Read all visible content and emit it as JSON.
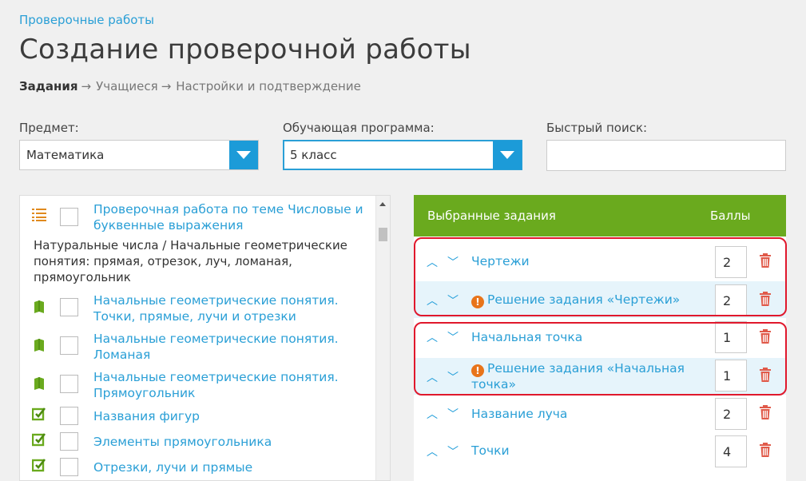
{
  "breadcrumb": "Проверочные работы",
  "title": "Создание проверочной работы",
  "steps": {
    "step1": "Задания",
    "arrow": "→",
    "step2": "Учащиеся",
    "step3": "Настройки и подтверждение"
  },
  "filters": {
    "subject_label": "Предмет:",
    "subject_value": "Математика",
    "program_label": "Обучающая программа:",
    "program_value": "5 класс",
    "search_label": "Быстрый поиск:",
    "search_value": ""
  },
  "task_list": {
    "items": [
      {
        "icon": "list-icon",
        "text": "Проверочная работа по теме Числовые и буквенные выражения"
      },
      {
        "icon": "book-icon",
        "text": "Начальные геометрические понятия. Точки, прямые, лучи и отрезки"
      },
      {
        "icon": "book-icon",
        "text": "Начальные геометрические понятия. Ломаная"
      },
      {
        "icon": "book-icon",
        "text": "Начальные геометрические понятия. Прямоугольник"
      },
      {
        "icon": "edit-check-icon",
        "text": "Названия фигур"
      },
      {
        "icon": "edit-check-icon",
        "text": "Элементы прямоугольника"
      },
      {
        "icon": "edit-check-icon",
        "text": "Отрезки, лучи и прямые"
      }
    ],
    "group_heading": "Натуральные числа / Начальные геометрические понятия: прямая, отрезок, луч, ломаная, прямоугольник"
  },
  "selected": {
    "header_title": "Выбранные задания",
    "header_score": "Баллы",
    "rows": [
      {
        "label": "Чертежи",
        "score": "2",
        "warning": false
      },
      {
        "label": "Решение задания «Чертежи»",
        "score": "2",
        "warning": true
      },
      {
        "label": "Начальная точка",
        "score": "1",
        "warning": false
      },
      {
        "label": "Решение задания «Начальная точка»",
        "score": "1",
        "warning": true
      },
      {
        "label": "Название луча",
        "score": "2",
        "warning": false
      },
      {
        "label": "Точки",
        "score": "4",
        "warning": false
      }
    ]
  },
  "colors": {
    "accent": "#1c9bd8",
    "link": "#2a9fd6",
    "header_green": "#6aaa1e",
    "highlight": "#e0182c",
    "delete": "#e05a4a",
    "warning": "#e8741a"
  }
}
